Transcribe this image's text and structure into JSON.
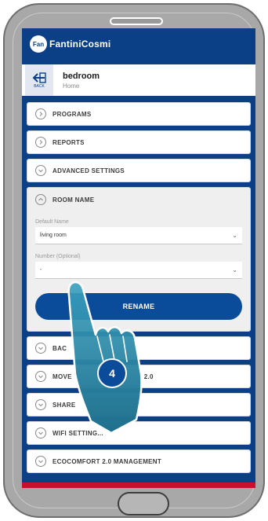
{
  "app": {
    "brand": "FantiniCosmi",
    "brand_mark": "Fan",
    "room_title": "bedroom",
    "room_subtitle": "Home",
    "back_label": "BACK"
  },
  "menu": {
    "programs": "PROGRAMS",
    "reports": "REPORTS",
    "advanced_settings": "ADVANCED SETTINGS",
    "room_name": "ROOM NAME",
    "backup": "BAC",
    "moves": "MOVE",
    "moves_suffix": "2.0",
    "share": "SHARE",
    "wifi_settings": "WIFI SETTING...",
    "ecocomfort": "ECOCOMFORT 2.0 MANAGEMENT"
  },
  "room_name_panel": {
    "default_name_label": "Default Name",
    "default_name_value": "living room",
    "number_label": "Number (Optional)",
    "number_value": "-",
    "rename_label": "RENAME"
  },
  "tutorial": {
    "step_number": "4"
  },
  "colors": {
    "brand_blue": "#0b3f86",
    "button_blue": "#0b4c9a",
    "accent_red": "#c8102e",
    "hand_teal": "#2a8aa8"
  }
}
